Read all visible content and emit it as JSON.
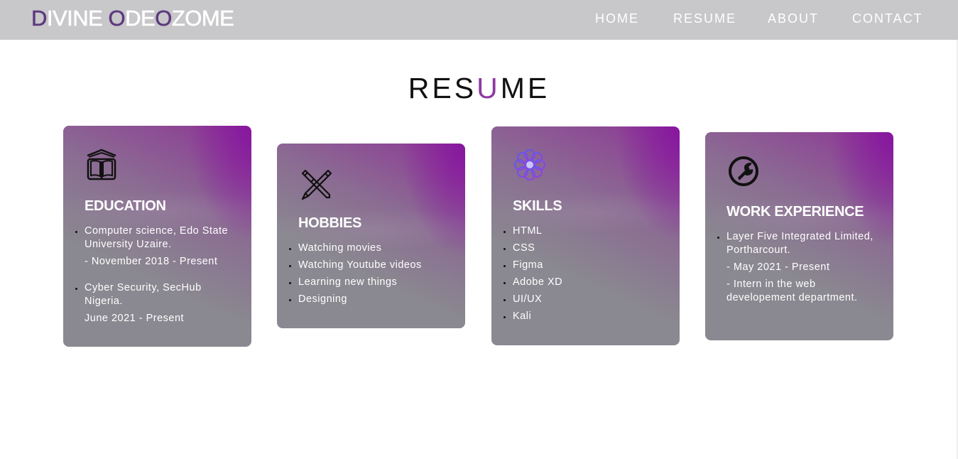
{
  "header": {
    "logo": {
      "parts": [
        {
          "text": "D",
          "accent": true
        },
        {
          "text": "IVINE ",
          "accent": false
        },
        {
          "text": "O",
          "accent": true
        },
        {
          "text": "DE",
          "accent": false
        },
        {
          "text": "O",
          "accent": true
        },
        {
          "text": "ZOME",
          "accent": false
        }
      ]
    },
    "nav": [
      {
        "label": "HOME"
      },
      {
        "label": "RESUME"
      },
      {
        "label": "ABOUT"
      },
      {
        "label": "CONTACT"
      }
    ]
  },
  "page_title": {
    "before": "RES",
    "accent": "U",
    "after": "ME"
  },
  "cards": [
    {
      "title": "EDUCATION",
      "icon": "book-icon",
      "items": [
        {
          "text": "Computer science, Edo State University Uzaire.",
          "bullet": true
        },
        {
          "text": "- November 2018 - Present",
          "bullet": false
        },
        {
          "text": "Cyber Security, SecHub Nigeria.",
          "bullet": true
        },
        {
          "text": "June 2021 - Present",
          "bullet": false
        }
      ]
    },
    {
      "title": "HOBBIES",
      "icon": "pen-ruler-icon",
      "items": [
        {
          "text": "Watching movies",
          "bullet": true
        },
        {
          "text": "Watching Youtube videos",
          "bullet": true
        },
        {
          "text": "Learning new things",
          "bullet": true
        },
        {
          "text": "Designing",
          "bullet": true
        }
      ]
    },
    {
      "title": "SKILLS",
      "icon": "gear-flower-icon",
      "items": [
        {
          "text": "HTML",
          "bullet": true
        },
        {
          "text": "CSS",
          "bullet": true
        },
        {
          "text": "Figma",
          "bullet": true
        },
        {
          "text": "Adobe XD",
          "bullet": true
        },
        {
          "text": "UI/UX",
          "bullet": true
        },
        {
          "text": "Kali",
          "bullet": true
        }
      ]
    },
    {
      "title": "WORK EXPERIENCE",
      "icon": "wrench-circle-icon",
      "items": [
        {
          "text": "Layer Five Integrated Limited, Portharcourt.",
          "bullet": true
        },
        {
          "text": "- May 2021 - Present",
          "bullet": false
        },
        {
          "text": "- Intern in the web developement department.",
          "bullet": false
        }
      ]
    }
  ],
  "colors": {
    "accent": "#5d3a7e",
    "title_accent": "#8e3aa3",
    "header_bg": "#c8c7ca",
    "card_bg": "#8a8890",
    "card_glow": "#87149f"
  }
}
